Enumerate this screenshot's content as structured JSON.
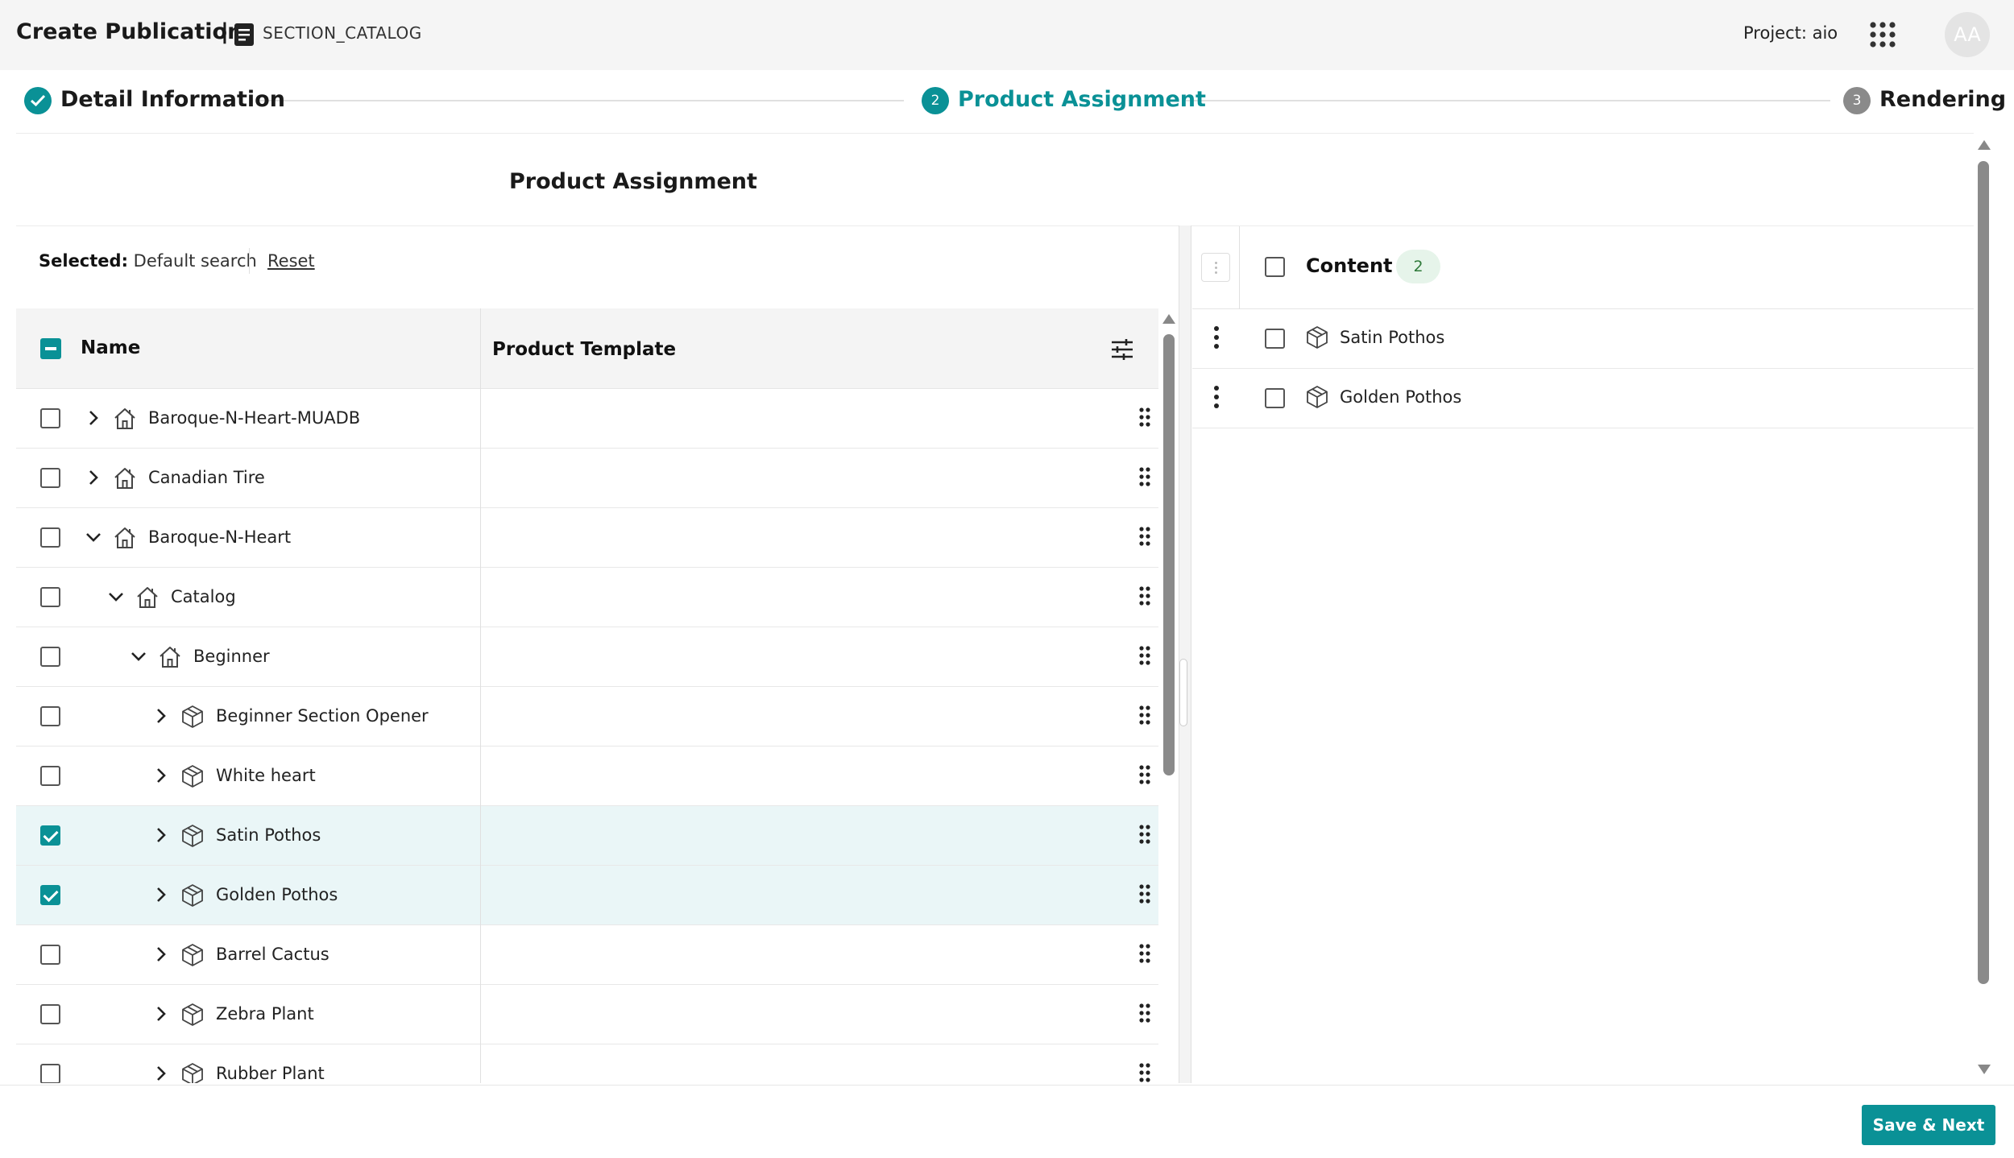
{
  "header": {
    "title": "Create Publication",
    "separator": "|",
    "section_icon": "document-icon",
    "section_name": "SECTION_CATALOG",
    "project_label": "Project: aio",
    "apps_icon": "apps-grid-icon",
    "avatar_initials": "AA"
  },
  "stepper": {
    "steps": [
      {
        "label": "Detail Information",
        "state": "completed",
        "number": ""
      },
      {
        "label": "Product Assignment",
        "state": "active",
        "number": "2"
      },
      {
        "label": "Rendering",
        "state": "pending",
        "number": "3"
      }
    ]
  },
  "colors": {
    "accent": "#0a9196",
    "selected_row": "#eaf6f7",
    "pending_step": "#8a8a8a",
    "badge_bg": "#e6f4ea",
    "badge_text": "#2f7a3a"
  },
  "main": {
    "panel_title": "Product Assignment",
    "selected_label": "Selected:",
    "selected_value": "Default search",
    "reset_label": "Reset"
  },
  "grid": {
    "columns": {
      "name": "Name",
      "template": "Product Template"
    },
    "rows": [
      {
        "label": "Baroque-N-Heart-MUADB",
        "icon": "house-icon",
        "level": 0,
        "expanded": false,
        "checked": false
      },
      {
        "label": "Canadian Tire",
        "icon": "house-icon",
        "level": 0,
        "expanded": false,
        "checked": false
      },
      {
        "label": "Baroque-N-Heart",
        "icon": "house-icon",
        "level": 0,
        "expanded": true,
        "checked": false
      },
      {
        "label": "Catalog",
        "icon": "house-icon",
        "level": 1,
        "expanded": true,
        "checked": false
      },
      {
        "label": "Beginner",
        "icon": "house-icon",
        "level": 2,
        "expanded": true,
        "checked": false
      },
      {
        "label": "Beginner Section Opener",
        "icon": "cube-icon",
        "level": 3,
        "expanded": false,
        "checked": false
      },
      {
        "label": "White heart",
        "icon": "cube-icon",
        "level": 3,
        "expanded": false,
        "checked": false
      },
      {
        "label": "Satin Pothos",
        "icon": "cube-icon",
        "level": 3,
        "expanded": false,
        "checked": true
      },
      {
        "label": "Golden Pothos",
        "icon": "cube-icon",
        "level": 3,
        "expanded": false,
        "checked": true
      },
      {
        "label": "Barrel Cactus",
        "icon": "cube-icon",
        "level": 3,
        "expanded": false,
        "checked": false
      },
      {
        "label": "Zebra Plant",
        "icon": "cube-icon",
        "level": 3,
        "expanded": false,
        "checked": false
      },
      {
        "label": "Rubber Plant",
        "icon": "cube-icon",
        "level": 3,
        "expanded": false,
        "checked": false
      }
    ]
  },
  "content_panel": {
    "title": "Content",
    "count": "2",
    "items": [
      {
        "label": "Satin Pothos",
        "icon": "cube-icon"
      },
      {
        "label": "Golden Pothos",
        "icon": "cube-icon"
      }
    ]
  },
  "footer": {
    "save_next_label": "Save & Next"
  }
}
